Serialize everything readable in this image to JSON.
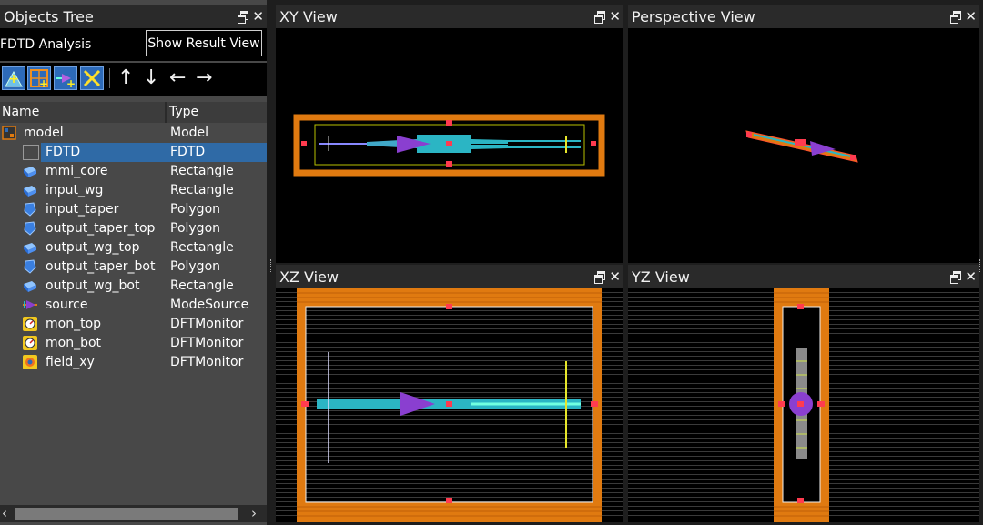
{
  "objects_tree": {
    "title": "Objects Tree",
    "analysis_label": "FDTD Analysis",
    "show_result_button": "Show Result View",
    "columns": {
      "name": "Name",
      "type": "Type"
    },
    "rows": [
      {
        "name": "model",
        "type": "Model",
        "icon": "model-icon",
        "selected": false
      },
      {
        "name": "FDTD",
        "type": "FDTD",
        "icon": "fdtd-region-icon",
        "selected": true
      },
      {
        "name": "mmi_core",
        "type": "Rectangle",
        "icon": "rectangle-icon",
        "selected": false
      },
      {
        "name": "input_wg",
        "type": "Rectangle",
        "icon": "rectangle-icon",
        "selected": false
      },
      {
        "name": "input_taper",
        "type": "Polygon",
        "icon": "polygon-icon",
        "selected": false
      },
      {
        "name": "output_taper_top",
        "type": "Polygon",
        "icon": "polygon-icon",
        "selected": false
      },
      {
        "name": "output_wg_top",
        "type": "Rectangle",
        "icon": "rectangle-icon",
        "selected": false
      },
      {
        "name": "output_taper_bot",
        "type": "Polygon",
        "icon": "polygon-icon",
        "selected": false
      },
      {
        "name": "output_wg_bot",
        "type": "Rectangle",
        "icon": "rectangle-icon",
        "selected": false
      },
      {
        "name": "source",
        "type": "ModeSource",
        "icon": "mode-source-icon",
        "selected": false
      },
      {
        "name": "mon_top",
        "type": "DFTMonitor",
        "icon": "dft-monitor-icon",
        "selected": false
      },
      {
        "name": "mon_bot",
        "type": "DFTMonitor",
        "icon": "dft-monitor-icon",
        "selected": false
      },
      {
        "name": "field_xy",
        "type": "DFTMonitor",
        "icon": "field-monitor-icon",
        "selected": false
      }
    ],
    "toolbar_icons": [
      "add-structure-icon",
      "add-region-icon",
      "add-source-icon",
      "delete-icon"
    ],
    "move_arrows": [
      "↑",
      "↓",
      "←",
      "→"
    ]
  },
  "views": {
    "xy": {
      "title": "XY View"
    },
    "perspective": {
      "title": "Perspective View"
    },
    "xz": {
      "title": "XZ View"
    },
    "yz": {
      "title": "YZ View"
    }
  },
  "colors": {
    "boundary": "#e07a10",
    "structure": "#2bb5c4",
    "source": "#8a3fd0",
    "monitor": "#e6e62a",
    "marker": "#ff3b4f",
    "selection": "#2f6aa6"
  }
}
